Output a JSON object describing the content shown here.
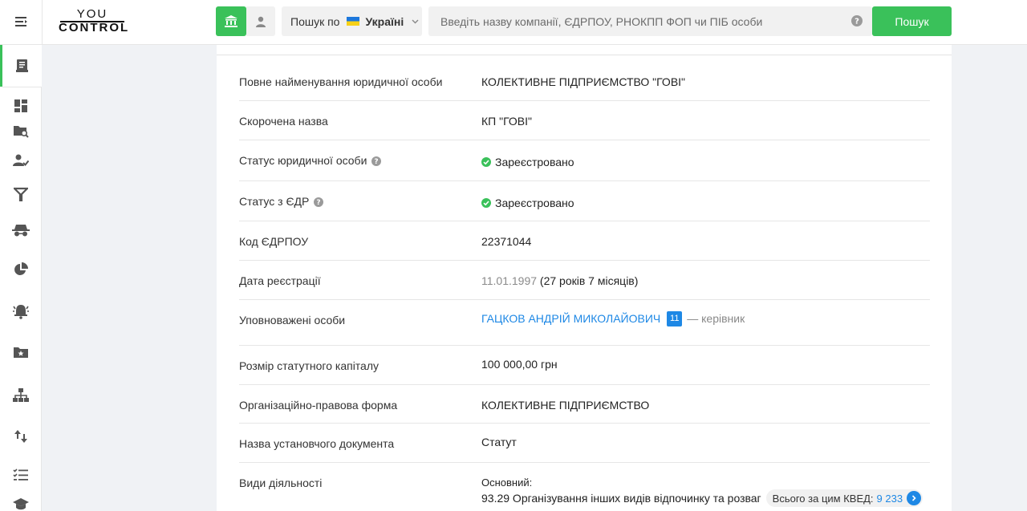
{
  "header": {
    "logo_line1": "YOU",
    "logo_line2": "CONTROL",
    "region_prefix": "Пошук по",
    "region_value": "Україні",
    "search_placeholder": "Введіть назву компанії, ЄДРПОУ, РНОКПП ФОП чи ПІБ особи",
    "search_button": "Пошук"
  },
  "sidebar": {
    "icons": [
      "menu-icon",
      "document-icon",
      "dashboard-icon",
      "folder-search-icon",
      "person-check-icon",
      "filter-icon",
      "spy-icon",
      "pie-chart-icon",
      "alarm-icon",
      "star-folder-icon",
      "structure-icon",
      "transfer-icon",
      "checklist-icon",
      "graduation-cap-icon"
    ]
  },
  "company": {
    "rows": [
      {
        "label": "Повне найменування юридичної особи",
        "value": "КОЛЕКТИВНЕ ПІДПРИЄМСТВО \"ГОВІ\""
      },
      {
        "label": "Скорочена назва",
        "value": "КП \"ГОВІ\""
      },
      {
        "label": "Статус юридичної особи",
        "value": "Зареєстровано"
      },
      {
        "label": "Статус з ЄДР",
        "value": "Зареєстровано"
      },
      {
        "label": "Код ЄДРПОУ",
        "value": "22371044"
      },
      {
        "label": "Дата реєстрації",
        "date": "11.01.1997",
        "age": "(27 років 7 місяців)"
      },
      {
        "label": "Уповноважені особи",
        "person": "ГАЦКОВ АНДРІЙ МИКОЛАЙОВИЧ",
        "badge": "11",
        "role": "— керівник"
      },
      {
        "label": "Розмір статутного капіталу",
        "value": "100 000,00 грн"
      },
      {
        "label": "Організаційно-правова форма",
        "value": "КОЛЕКТИВНЕ ПІДПРИЄМСТВО"
      },
      {
        "label": "Назва установчого документа",
        "value": "Статут"
      },
      {
        "label": "Види діяльності",
        "sub": "Основний:",
        "value": "93.29 Організування інших видів відпочинку та розваг",
        "pill_label": "Всього за цим КВЕД:",
        "pill_num": "9 233"
      }
    ]
  },
  "colors": {
    "accent": "#3ac15a",
    "link": "#1e88e5"
  }
}
